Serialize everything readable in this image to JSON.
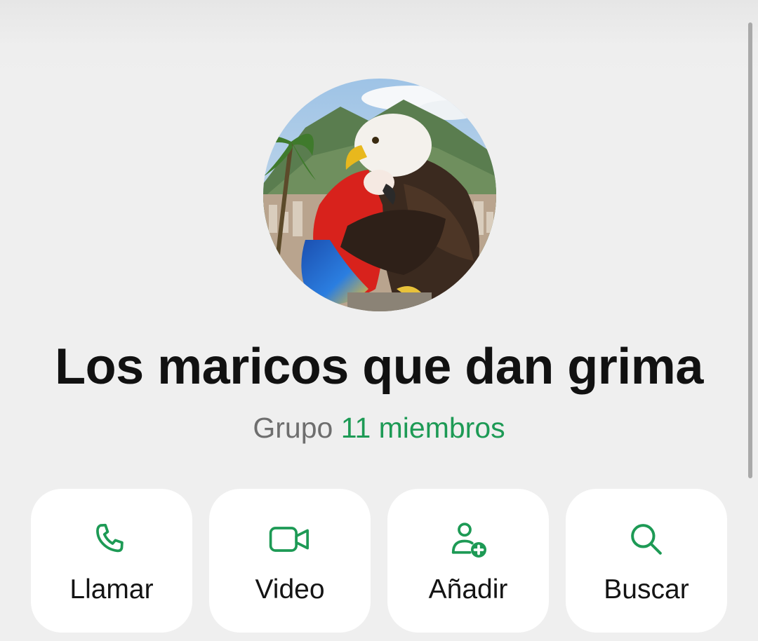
{
  "group": {
    "name": "Los maricos que dan grima",
    "kind": "Grupo",
    "members": "11 miembros",
    "accent_color": "#1d9a55"
  },
  "actions": [
    {
      "label": "Llamar",
      "icon": "phone-icon"
    },
    {
      "label": "Video",
      "icon": "video-camera-icon"
    },
    {
      "label": "Añadir",
      "icon": "add-person-icon"
    },
    {
      "label": "Buscar",
      "icon": "search-icon"
    }
  ]
}
